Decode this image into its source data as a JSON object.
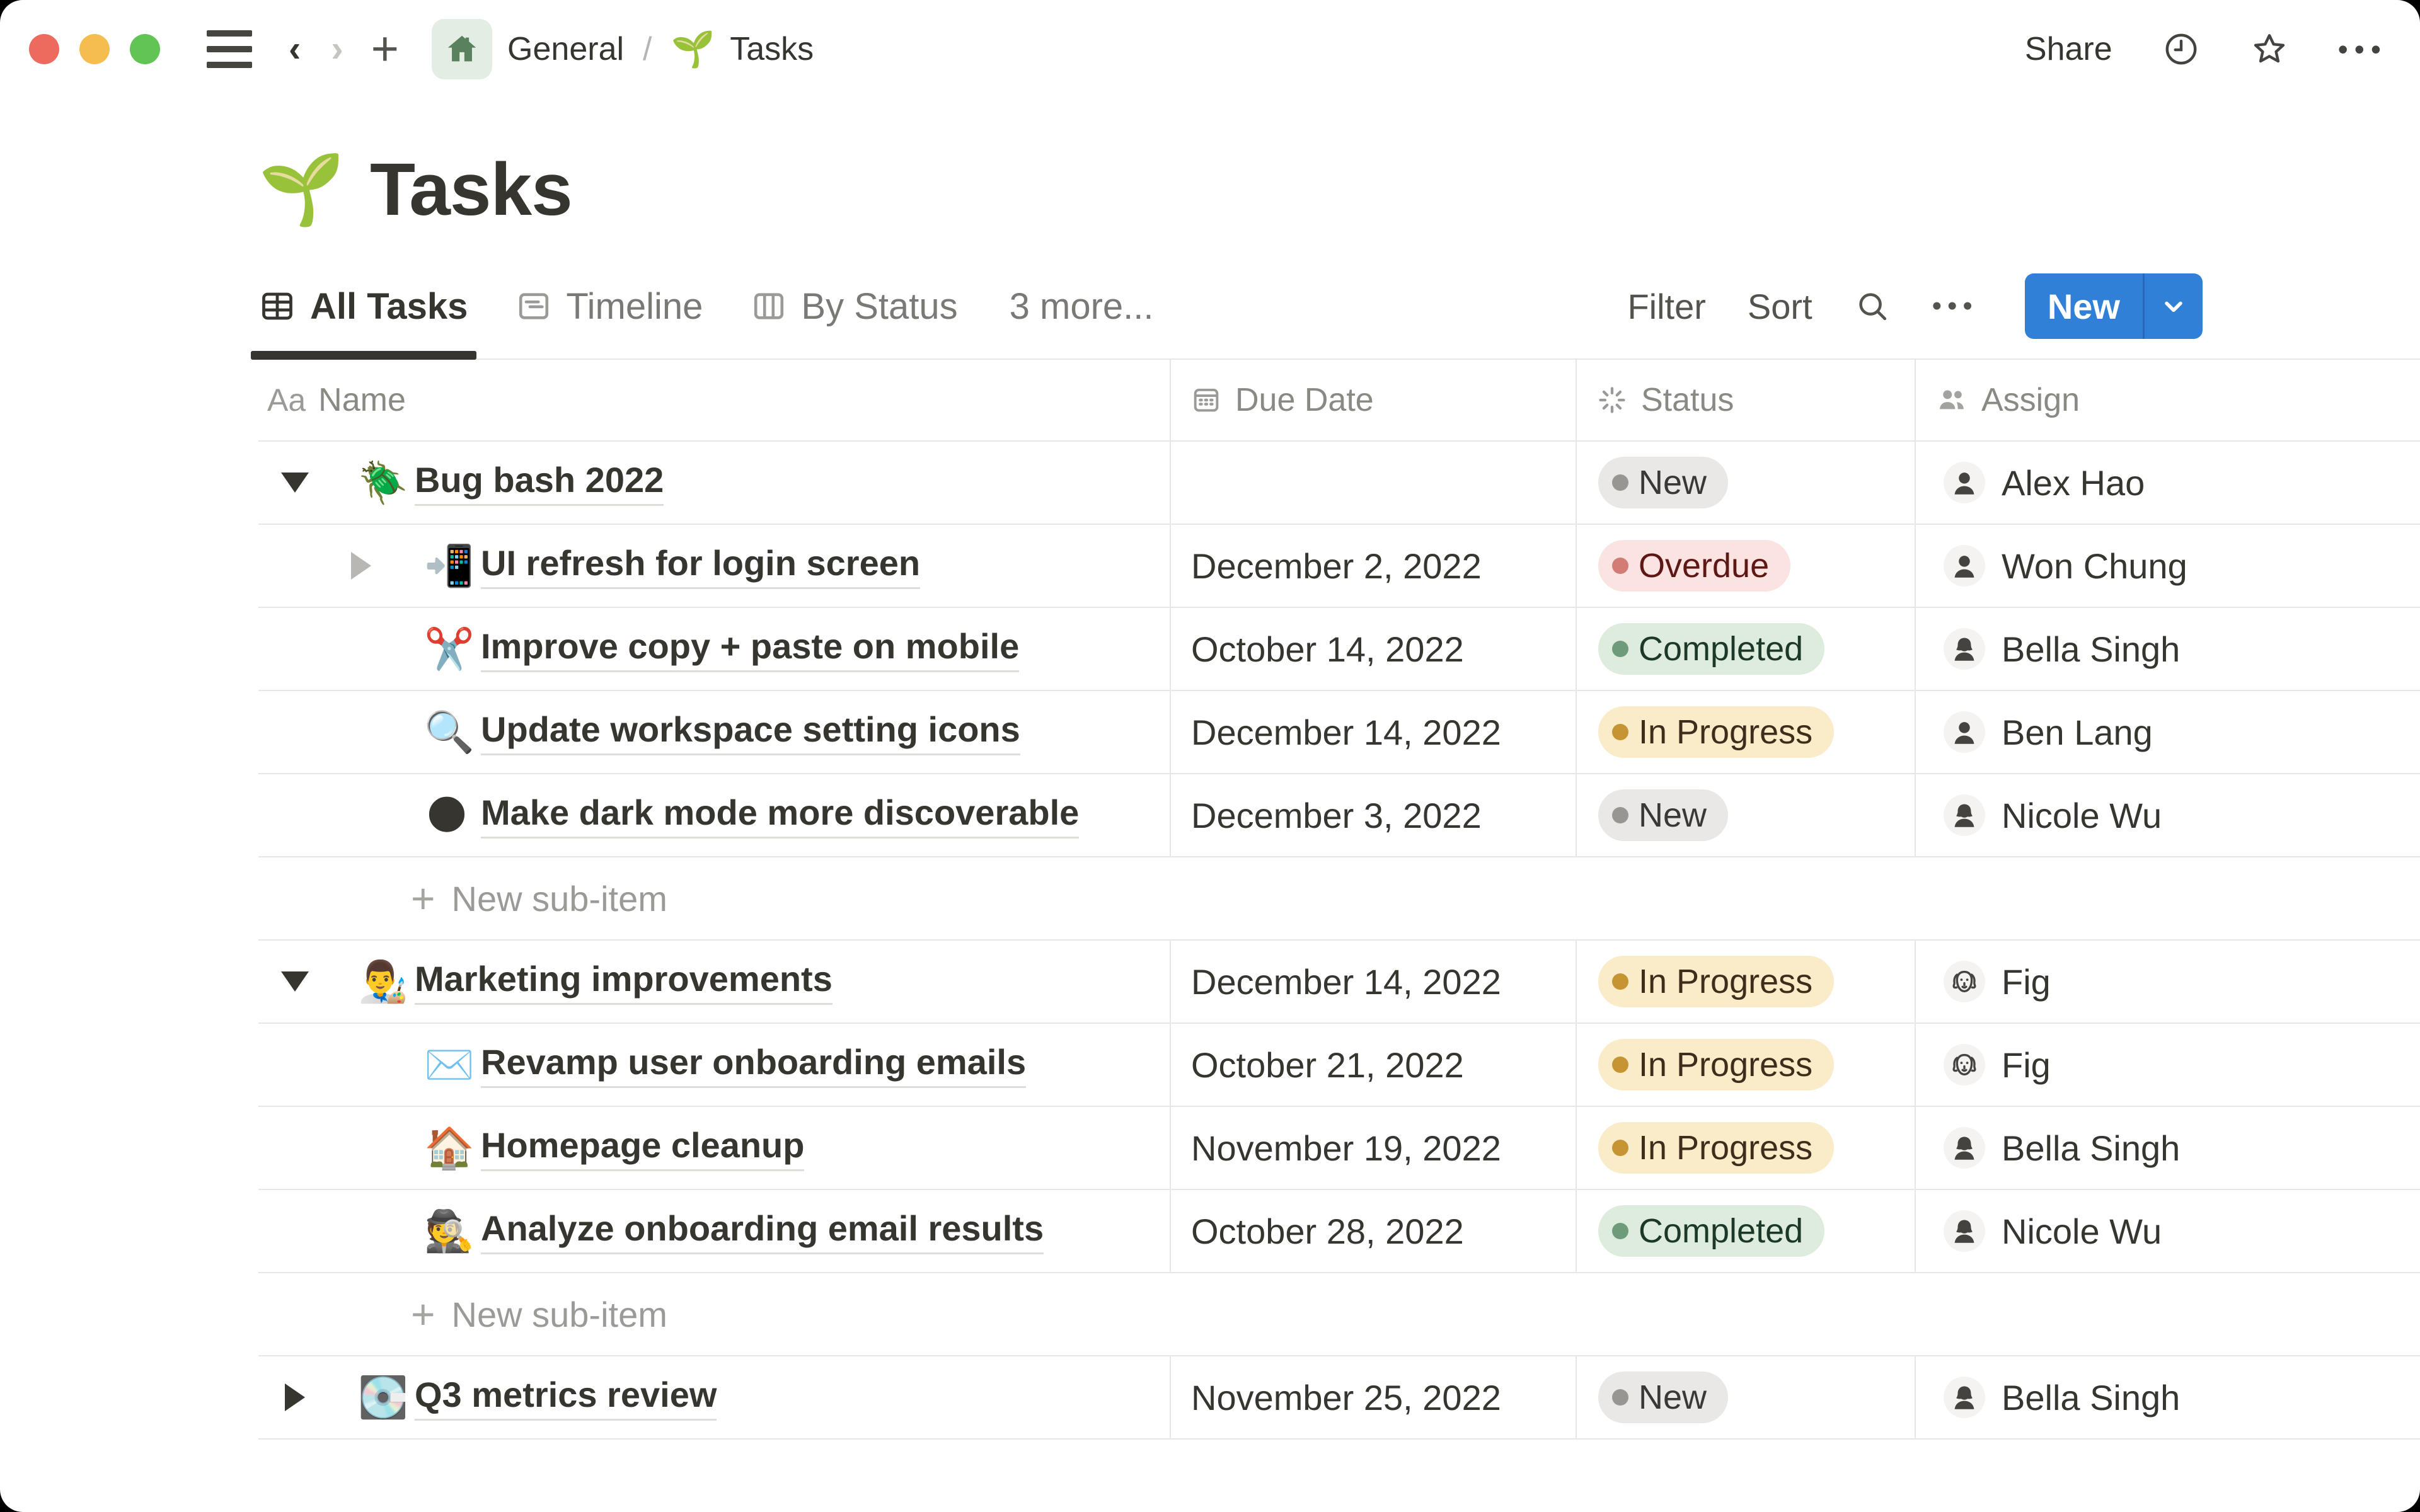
{
  "topbar": {
    "breadcrumb": {
      "workspace": "General",
      "separator": "/",
      "page_icon": "🌱",
      "page": "Tasks"
    },
    "share_label": "Share",
    "more_icon": "•••"
  },
  "page": {
    "icon": "🌱",
    "title": "Tasks"
  },
  "view_tabs": [
    {
      "label": "All Tasks",
      "icon": "table-icon",
      "active": true
    },
    {
      "label": "Timeline",
      "icon": "timeline-icon",
      "active": false
    },
    {
      "label": "By Status",
      "icon": "board-icon",
      "active": false
    },
    {
      "label": "3 more...",
      "icon": null,
      "active": false
    }
  ],
  "toolbar": {
    "filter_label": "Filter",
    "sort_label": "Sort",
    "more_icon": "•••",
    "new_label": "New"
  },
  "table": {
    "columns": [
      {
        "label": "Name",
        "icon": "text-icon",
        "icon_glyph": "Aa"
      },
      {
        "label": "Due Date",
        "icon": "calendar-icon"
      },
      {
        "label": "Status",
        "icon": "status-burst-icon"
      },
      {
        "label": "Assign",
        "icon": "people-icon"
      }
    ],
    "new_sub_item_label": "New sub-item",
    "rows": [
      {
        "type": "parent",
        "expanded": true,
        "icon": "🪲",
        "name": "Bug bash 2022",
        "due": "",
        "status": "New",
        "status_key": "new",
        "assignee": "Alex Hao",
        "avatar": "man"
      },
      {
        "type": "child",
        "has_toggle": true,
        "icon": "📲",
        "name": "UI refresh for login screen",
        "due": "December 2, 2022",
        "status": "Overdue",
        "status_key": "overdue",
        "assignee": "Won Chung",
        "avatar": "man"
      },
      {
        "type": "child",
        "icon": "✂️",
        "name": "Improve copy + paste on mobile",
        "due": "October 14, 2022",
        "status": "Completed",
        "status_key": "completed",
        "assignee": "Bella Singh",
        "avatar": "woman"
      },
      {
        "type": "child",
        "icon": "🔍",
        "name": "Update workspace setting icons",
        "due": "December 14, 2022",
        "status": "In Progress",
        "status_key": "inprogress",
        "assignee": "Ben Lang",
        "avatar": "man"
      },
      {
        "type": "child",
        "icon": "🌑",
        "name": "Make dark mode more discoverable",
        "due": "December 3, 2022",
        "status": "New",
        "status_key": "new",
        "assignee": "Nicole Wu",
        "avatar": "woman"
      },
      {
        "type": "newsub"
      },
      {
        "type": "parent",
        "expanded": true,
        "icon": "👨‍🎨",
        "name": "Marketing improvements",
        "due": "December 14, 2022",
        "status": "In Progress",
        "status_key": "inprogress",
        "assignee": "Fig",
        "avatar": "dog"
      },
      {
        "type": "child",
        "icon": "✉️",
        "name": "Revamp user onboarding emails",
        "due": "October 21, 2022",
        "status": "In Progress",
        "status_key": "inprogress",
        "assignee": "Fig",
        "avatar": "dog"
      },
      {
        "type": "child",
        "icon": "🏠",
        "name": "Homepage cleanup",
        "due": "November 19, 2022",
        "status": "In Progress",
        "status_key": "inprogress",
        "assignee": "Bella Singh",
        "avatar": "woman"
      },
      {
        "type": "child",
        "icon": "🕵️",
        "name": "Analyze onboarding email results",
        "due": "October 28, 2022",
        "status": "Completed",
        "status_key": "completed",
        "assignee": "Nicole Wu",
        "avatar": "woman"
      },
      {
        "type": "newsub"
      },
      {
        "type": "parent",
        "expanded": false,
        "icon": "💽",
        "name": "Q3 metrics review",
        "due": "November 25, 2022",
        "status": "New",
        "status_key": "new",
        "assignee": "Bella Singh",
        "avatar": "woman"
      }
    ]
  },
  "colors": {
    "accent_blue": "#2F80D6",
    "new_button_divider": "#2569B8",
    "traffic_lights": {
      "close": "#ED6A5E",
      "minimize": "#F5BD4F",
      "zoom": "#61C454"
    },
    "home_badge_bg": "#E3EDE3",
    "home_badge_glyph": "#59815E",
    "status": {
      "new": {
        "bg": "#E9E8E6",
        "dot": "#979692",
        "text": "#3A3835"
      },
      "overdue": {
        "bg": "#FAE3E0",
        "dot": "#D27C75",
        "text": "#5D1715"
      },
      "completed": {
        "bg": "#DEECDD",
        "dot": "#6E9B7A",
        "text": "#1C3829"
      },
      "in_progress": {
        "bg": "#FBECC9",
        "dot": "#C79434",
        "text": "#402C1B"
      }
    }
  }
}
